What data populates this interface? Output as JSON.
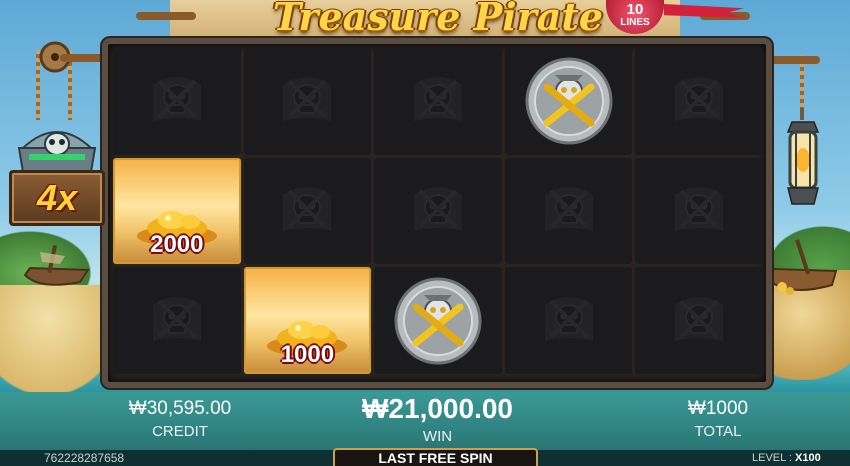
{
  "game": {
    "title": "Treasure Pirate",
    "lines_count": "10",
    "lines_label": "LINES",
    "multiplier": "4x"
  },
  "reels": {
    "rows": [
      [
        "skull",
        "skull",
        "skull",
        "coin",
        "skull"
      ],
      [
        "gold",
        "skull",
        "skull",
        "skull",
        "skull"
      ],
      [
        "skull",
        "gold",
        "coin",
        "skull",
        "skull"
      ]
    ],
    "gold_values": {
      "1-0": "2000",
      "2-1": "1000"
    }
  },
  "stats": {
    "credit_value": "₩30,595.00",
    "credit_label": "CREDIT",
    "win_value": "₩21,000.00",
    "win_label": "WIN",
    "total_value": "₩1000",
    "total_label": "TOTAL"
  },
  "footer": {
    "round_id": "762228287658",
    "free_spin": "LAST FREE SPIN",
    "level_label": "LEVEL :",
    "level_value": "X100"
  },
  "colors": {
    "gold_text": "#ffd54a",
    "value_outline": "#7a0a12",
    "bar": "#2d7e7c"
  }
}
